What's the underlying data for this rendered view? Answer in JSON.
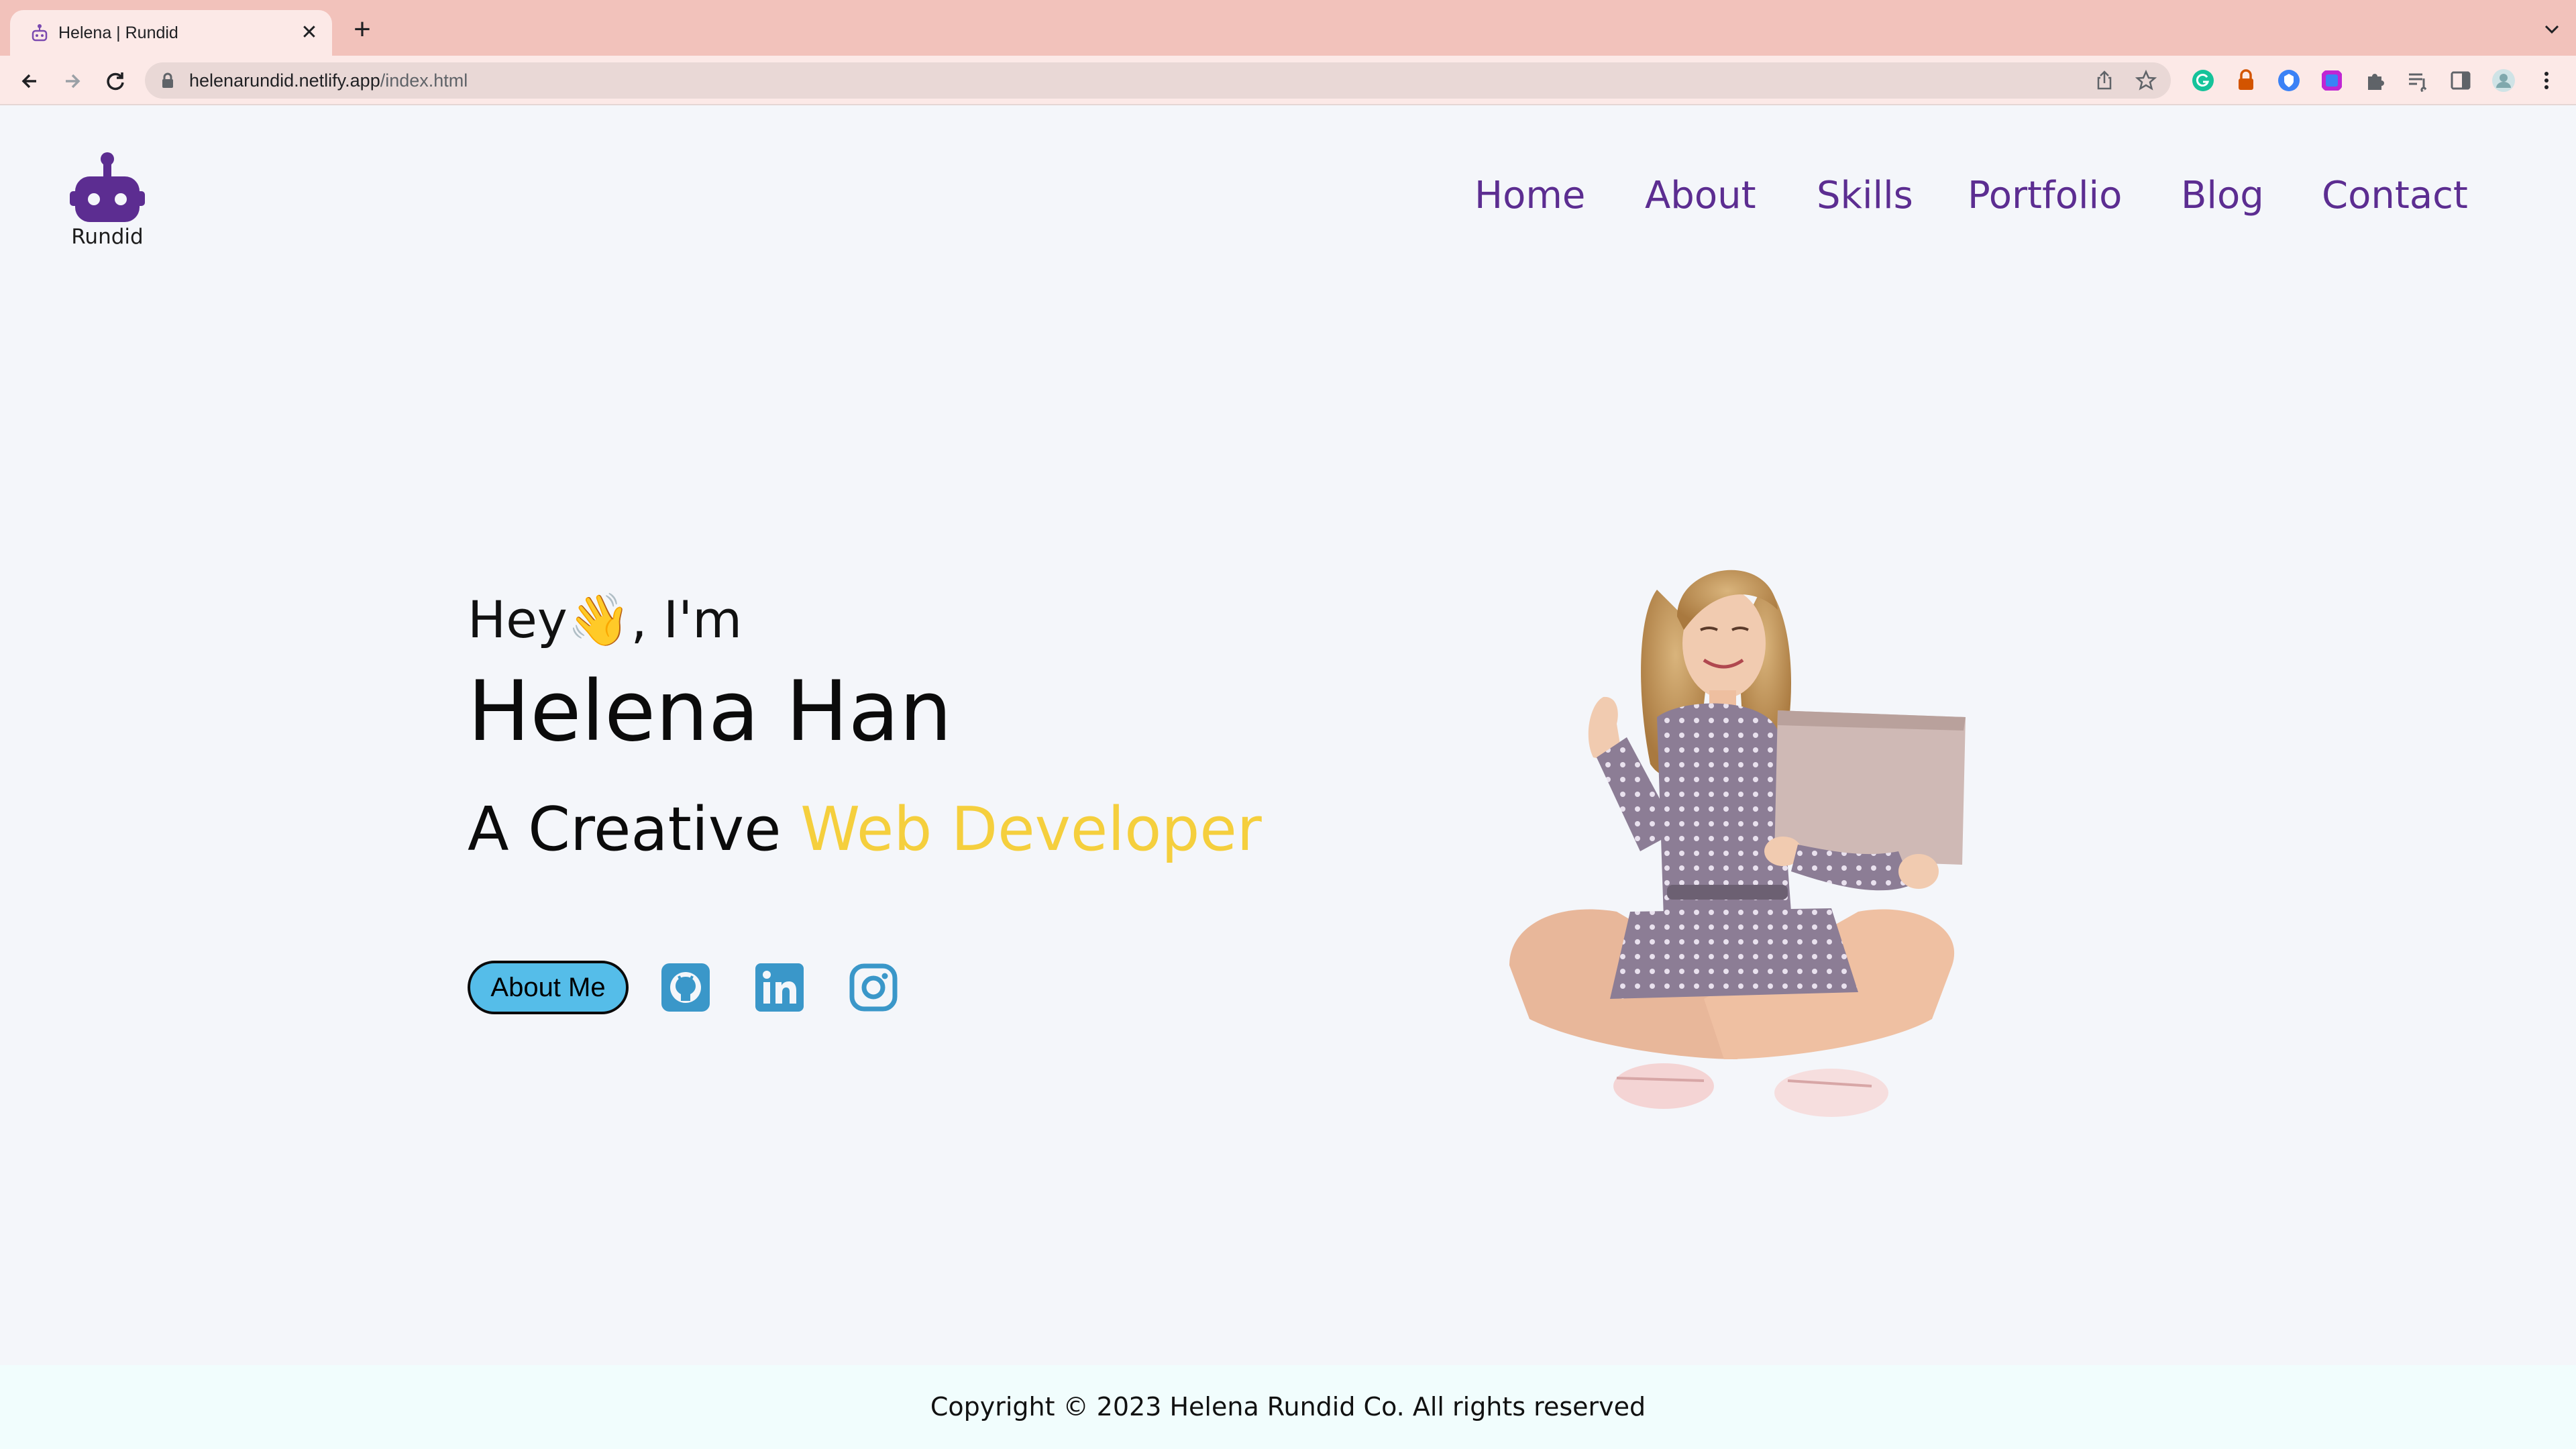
{
  "browser": {
    "tab_title": "Helena | Rundid",
    "tab_close": "✕",
    "new_tab": "+",
    "url_domain": "helenarundid.netlify.app",
    "url_path": "/index.html"
  },
  "site": {
    "logo_text": "Rundid",
    "nav": [
      "Home",
      "About",
      "Skills",
      "Portfolio",
      "Blog",
      "Contact"
    ]
  },
  "hero": {
    "greeting_before": "Hey",
    "greeting_emoji": "👋",
    "greeting_after": ", I'm",
    "name": "Helena Han",
    "title_prefix": "A Creative ",
    "title_accent": "Web Developer",
    "about_button": "About Me"
  },
  "social_icons": [
    "github-icon",
    "linkedin-icon",
    "instagram-icon"
  ],
  "footer": {
    "text": "Copyright © 2023 Helena Rundid Co. All rights reserved"
  },
  "colors": {
    "nav": "#5c2d91",
    "accent": "#f5cf3d",
    "button": "#55bde9",
    "social": "#3a97c9",
    "tabbar": "#f2c2bb"
  }
}
